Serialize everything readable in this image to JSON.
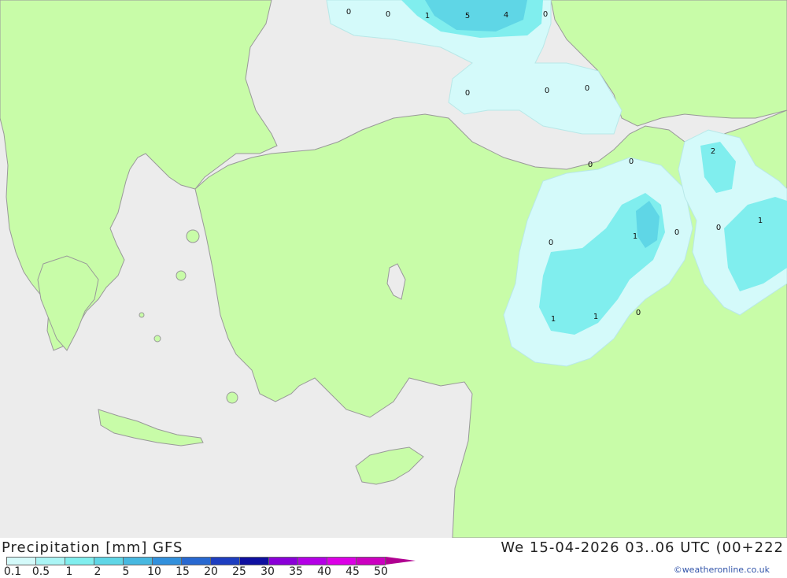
{
  "header": {
    "title": "Precipitation [mm] GFS",
    "datetime": "We 15-04-2026 03..06 UTC (00+222",
    "credit": "©weatheronline.co.uk"
  },
  "legend": {
    "levels": [
      "0.1",
      "0.5",
      "1",
      "2",
      "5",
      "10",
      "15",
      "20",
      "25",
      "30",
      "35",
      "40",
      "45",
      "50"
    ],
    "colors": [
      "#d4fafa",
      "#aaf5f5",
      "#80eeee",
      "#5fd6e6",
      "#47b8e0",
      "#3290dc",
      "#2868d0",
      "#1e3ec0",
      "#0f10a0",
      "#8a00d8",
      "#b400e6",
      "#dc00e6",
      "#cc00c0",
      "#b00090"
    ]
  },
  "map": {
    "land_color": "#c8fca8",
    "sea_color": "#ececec",
    "border_color": "#999999",
    "contour_labels": [
      "0",
      "0",
      "1",
      "5",
      "4",
      "0",
      "0",
      "0",
      "0",
      "0",
      "0",
      "2",
      "0",
      "1",
      "0",
      "0",
      "1",
      "1",
      "1",
      "0"
    ]
  }
}
